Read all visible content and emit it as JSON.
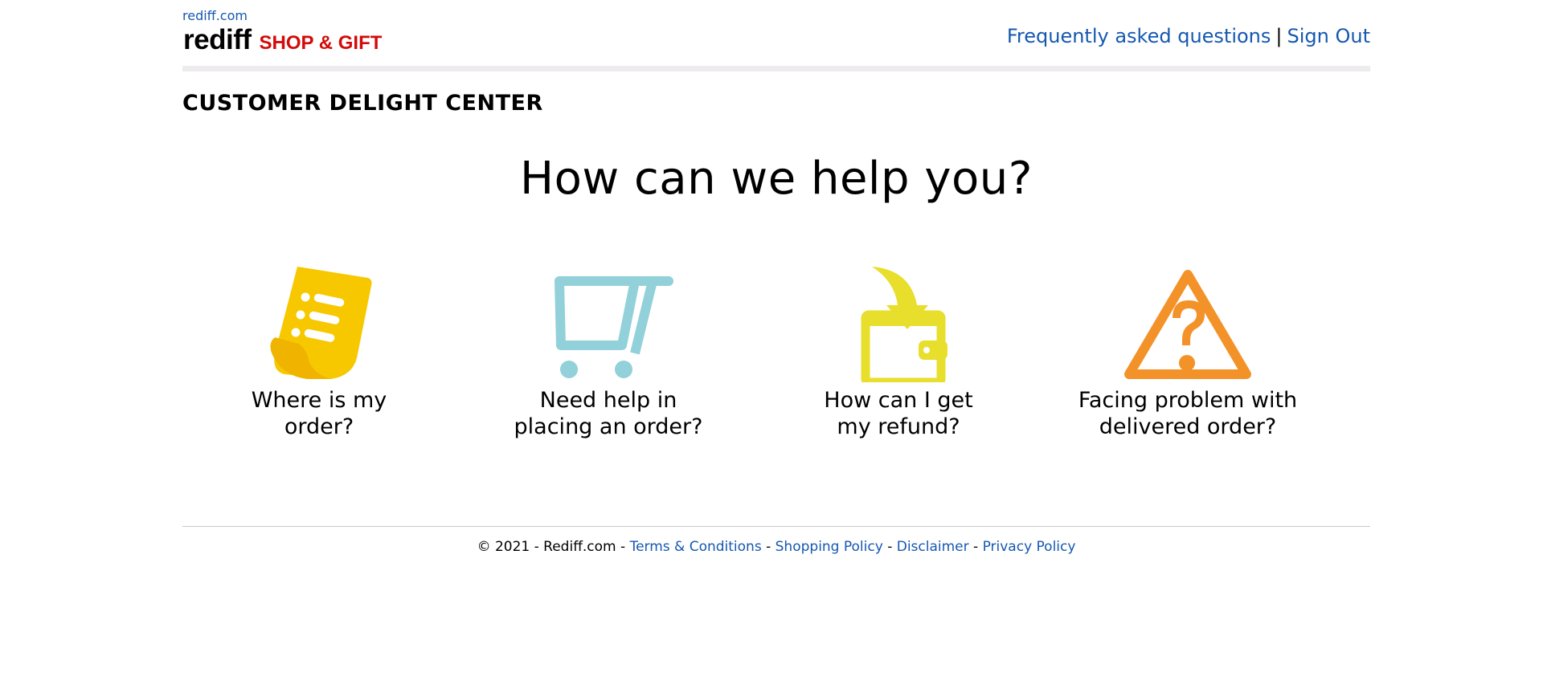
{
  "header": {
    "site_link": "rediff.com",
    "logo_main": "rediff",
    "logo_sub": "SHOP & GIFT",
    "nav": {
      "faq": "Frequently asked questions",
      "separator": "|",
      "sign_out": "Sign Out"
    }
  },
  "main": {
    "section_title": "CUSTOMER DELIGHT CENTER",
    "headline": "How can we help you?",
    "options": [
      {
        "icon": "order-receipt-icon",
        "color": "#f7c800",
        "line1": "Where is my",
        "line2": "order?"
      },
      {
        "icon": "shopping-cart-icon",
        "color": "#92d0da",
        "line1": "Need help in",
        "line2": "placing an order?"
      },
      {
        "icon": "refund-wallet-icon",
        "color": "#e8de2c",
        "line1": "How can I get",
        "line2": "my refund?"
      },
      {
        "icon": "warning-question-icon",
        "color": "#f39229",
        "line1": "Facing problem with",
        "line2": "delivered order?"
      }
    ]
  },
  "footer": {
    "copyright": "© 2021 - Rediff.com",
    "dash": "-",
    "links": [
      "Terms & Conditions",
      "Shopping Policy",
      "Disclaimer",
      "Privacy Policy"
    ]
  },
  "colors": {
    "link": "#1558b0",
    "brand_red": "#d40a0a",
    "header_rule": "#eeebee"
  }
}
